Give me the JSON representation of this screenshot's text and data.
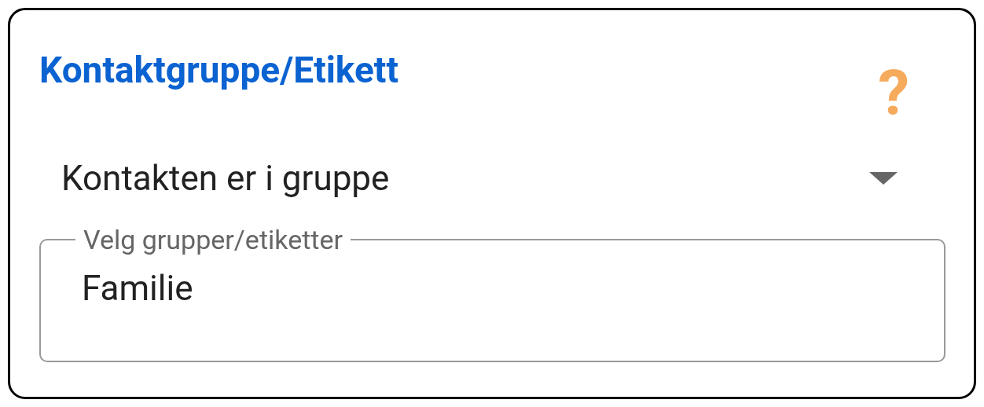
{
  "title": "Kontaktgruppe/Etikett",
  "help": "?",
  "condition": {
    "value": "Kontakten er i gruppe"
  },
  "groups_field": {
    "label": "Velg grupper/etiketter",
    "value": "Familie"
  }
}
